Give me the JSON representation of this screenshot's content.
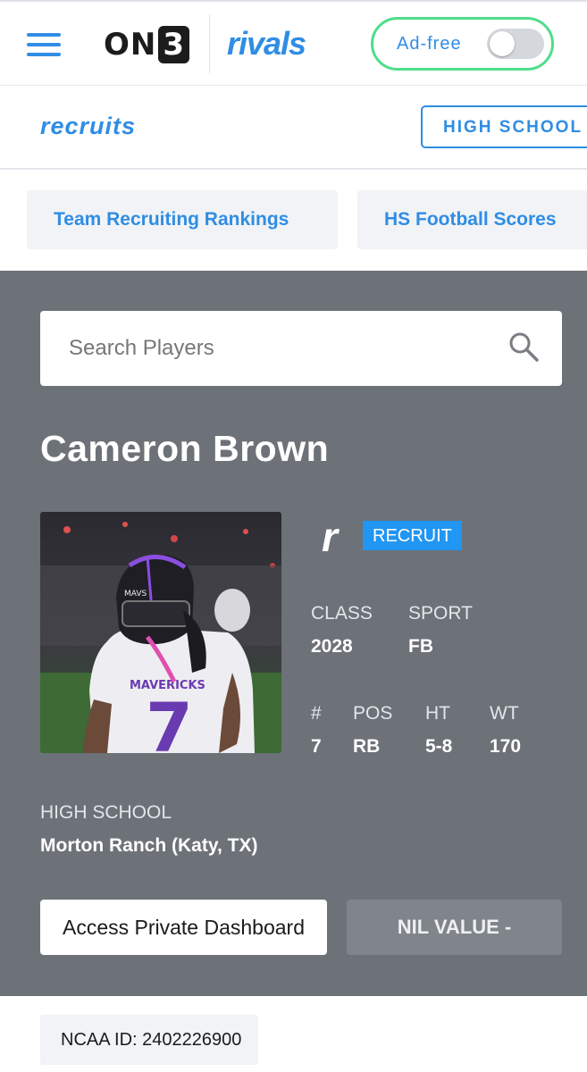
{
  "header": {
    "menu_icon": "hamburger-menu-icon",
    "on3_logo": "ON",
    "on3_logo_digit": "3",
    "rivals_logo": "rivals",
    "adfree_label": "Ad-free",
    "adfree_enabled": false,
    "brand_color": "#2f8de4",
    "adfree_outline_color": "#4fde8a"
  },
  "subnav": {
    "recruits_logo": "recruits",
    "high_school_button": "HIGH SCHOOL"
  },
  "quick_links": [
    "Team Recruiting Rankings",
    "HS Football Scores"
  ],
  "search": {
    "placeholder": "Search Players",
    "icon": "search-icon"
  },
  "player": {
    "name": "Cameron Brown",
    "badge_logo": "r",
    "badge": "RECRUIT",
    "stats_row1": [
      {
        "label": "CLASS",
        "value": "2028"
      },
      {
        "label": "SPORT",
        "value": "FB"
      }
    ],
    "stats_row2": [
      {
        "label": "#",
        "value": "7"
      },
      {
        "label": "POS",
        "value": "RB"
      },
      {
        "label": "HT",
        "value": "5-8"
      },
      {
        "label": "WT",
        "value": "170"
      }
    ],
    "high_school_label": "HIGH SCHOOL",
    "high_school": "Morton Ranch (Katy, TX)",
    "photo_jersey_text": "MAVERICKS",
    "photo_jersey_number": "7",
    "photo_helmet_text": "MAVS"
  },
  "actions": {
    "dashboard_button": "Access Private Dashboard",
    "nil_button": "NIL VALUE -"
  },
  "ncaa": {
    "label": "NCAA ID:",
    "value": "2402226900"
  },
  "colors": {
    "profile_background": "#6d7178",
    "badge_blue": "#2196f3"
  }
}
